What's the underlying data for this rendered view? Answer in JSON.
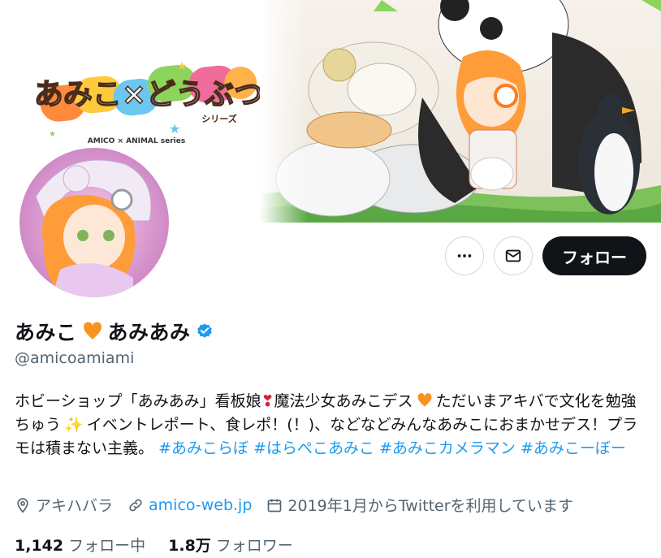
{
  "banner": {
    "logo_title": "あみこ×どうぶつ",
    "logo_sub": "シリーズ",
    "logo_caption": "AMICO × ANIMAL series"
  },
  "actions": {
    "more_icon": "more-icon",
    "message_icon": "mail-icon",
    "follow_label": "フォロー"
  },
  "profile": {
    "display_name_a": "あみこ",
    "display_name_b": "あみあみ",
    "verified_color": "#1d9bf0",
    "handle": "@amicoamiami"
  },
  "bio": {
    "part1": "ホビーショップ「あみあみ」看板娘",
    "part2": "魔法少女あみこデス",
    "part3": "ただいまアキバで文化を勉強ちゅう",
    "part4": "イベントレポート、食レポ！(！)、などなどみんなあみこにおまかせデス！プラモは積まない主義。",
    "hashtags": [
      "#あみこらぼ",
      "#はらぺこあみこ",
      "#あみこカメラマン",
      "#あみこーぼー"
    ]
  },
  "meta": {
    "location": "アキハバラ",
    "website": "amico-web.jp",
    "joined": "2019年1月からTwitterを利用しています"
  },
  "stats": {
    "following_count": "1,142",
    "following_label": "フォロー中",
    "followers_count": "1.8万",
    "followers_label": "フォロワー"
  }
}
